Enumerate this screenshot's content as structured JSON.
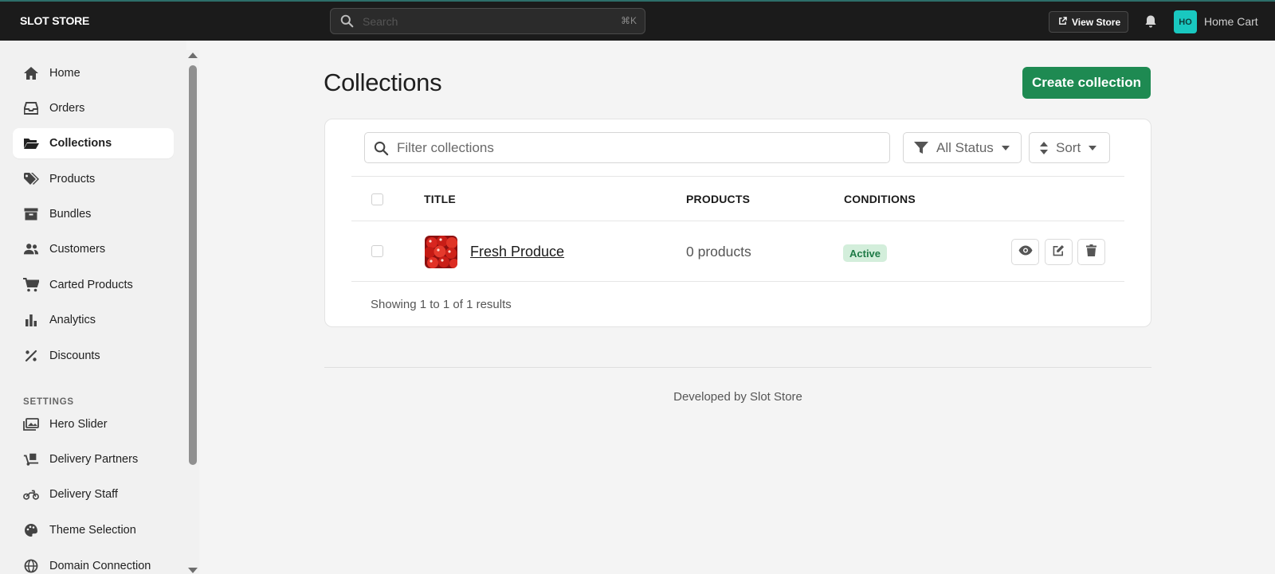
{
  "topbar": {
    "brand": "SLOT STORE",
    "search_placeholder": "Search",
    "search_shortcut": "⌘K",
    "view_store": "View Store",
    "avatar_initials": "HO",
    "user_name": "Home Cart"
  },
  "sidebar": {
    "items": [
      {
        "label": "Home",
        "icon": "home-icon"
      },
      {
        "label": "Orders",
        "icon": "inbox-icon"
      },
      {
        "label": "Collections",
        "icon": "folder-open-icon",
        "active": true
      },
      {
        "label": "Products",
        "icon": "tags-icon"
      },
      {
        "label": "Bundles",
        "icon": "archive-icon"
      },
      {
        "label": "Customers",
        "icon": "users-icon"
      },
      {
        "label": "Carted Products",
        "icon": "cart-icon"
      },
      {
        "label": "Analytics",
        "icon": "bar-chart-icon"
      },
      {
        "label": "Discounts",
        "icon": "percent-icon"
      }
    ],
    "settings_label": "SETTINGS",
    "settings_items": [
      {
        "label": "Hero Slider",
        "icon": "images-icon"
      },
      {
        "label": "Delivery Partners",
        "icon": "dolly-icon"
      },
      {
        "label": "Delivery Staff",
        "icon": "motorcycle-icon"
      },
      {
        "label": "Theme Selection",
        "icon": "palette-icon"
      },
      {
        "label": "Domain Connection",
        "icon": "globe-icon"
      }
    ]
  },
  "main": {
    "title": "Collections",
    "create_label": "Create collection",
    "filter_placeholder": "Filter collections",
    "status_label": "All Status",
    "sort_label": "Sort",
    "columns": [
      "TITLE",
      "PRODUCTS",
      "CONDITIONS"
    ],
    "rows": [
      {
        "title": "Fresh Produce",
        "products": "0 products",
        "status": "Active"
      }
    ],
    "showing": "Showing 1 to 1 of 1 results"
  },
  "footer": {
    "text": "Developed by Slot Store"
  },
  "colors": {
    "topbar": "#1b1b1b",
    "primary": "#1e8a52",
    "avatar": "#19c8c0",
    "badge_bg": "#d3eedb",
    "badge_text": "#1e7a46"
  }
}
